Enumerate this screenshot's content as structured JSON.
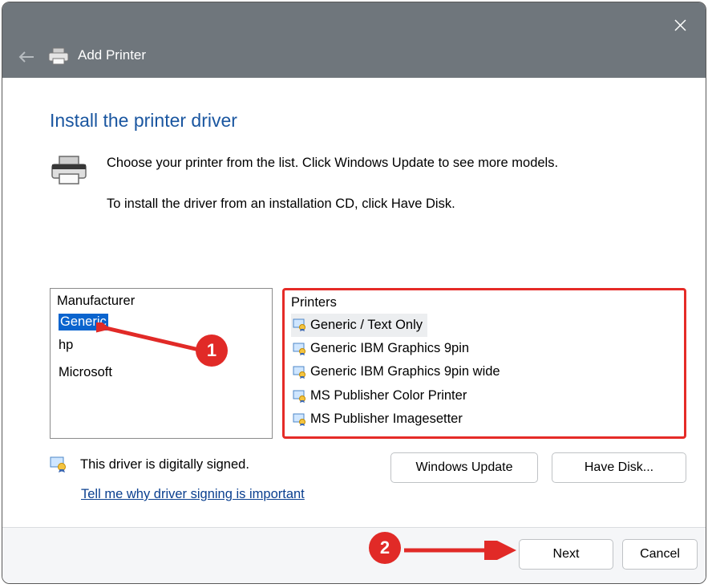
{
  "titlebar": {
    "title": "Add Printer"
  },
  "page": {
    "heading": "Install the printer driver",
    "instruction_line1": "Choose your printer from the list. Click Windows Update to see more models.",
    "instruction_line2": "To install the driver from an installation CD, click Have Disk."
  },
  "manufacturer": {
    "header": "Manufacturer",
    "items": [
      "Generic",
      "hp",
      "Microsoft"
    ],
    "selected": "Generic"
  },
  "printers": {
    "header": "Printers",
    "items": [
      "Generic / Text Only",
      "Generic IBM Graphics 9pin",
      "Generic IBM Graphics 9pin wide",
      "MS Publisher Color Printer",
      "MS Publisher Imagesetter"
    ],
    "selected": "Generic / Text Only"
  },
  "signing": {
    "status_text": "This driver is digitally signed.",
    "link_text": "Tell me why driver signing is important"
  },
  "buttons": {
    "windows_update": "Windows Update",
    "have_disk": "Have Disk...",
    "next": "Next",
    "cancel": "Cancel"
  },
  "annotations": {
    "badge1": "1",
    "badge2": "2"
  }
}
